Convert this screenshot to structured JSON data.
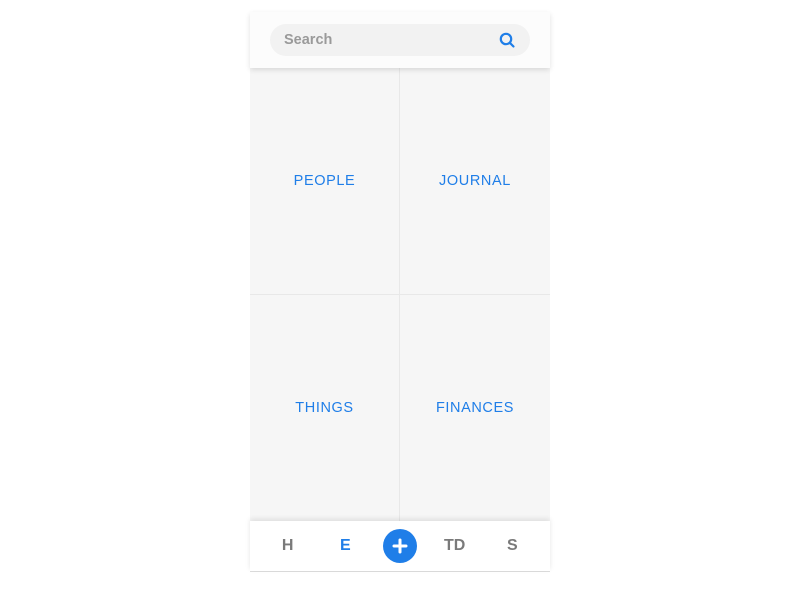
{
  "search": {
    "placeholder": "Search"
  },
  "tiles": [
    {
      "label": "PEOPLE"
    },
    {
      "label": "JOURNAL"
    },
    {
      "label": "THINGS"
    },
    {
      "label": "FINANCES"
    }
  ],
  "tabs": {
    "items": [
      {
        "label": "H"
      },
      {
        "label": "E"
      },
      {
        "label": "TD"
      },
      {
        "label": "S"
      }
    ],
    "activeIndex": 1
  }
}
